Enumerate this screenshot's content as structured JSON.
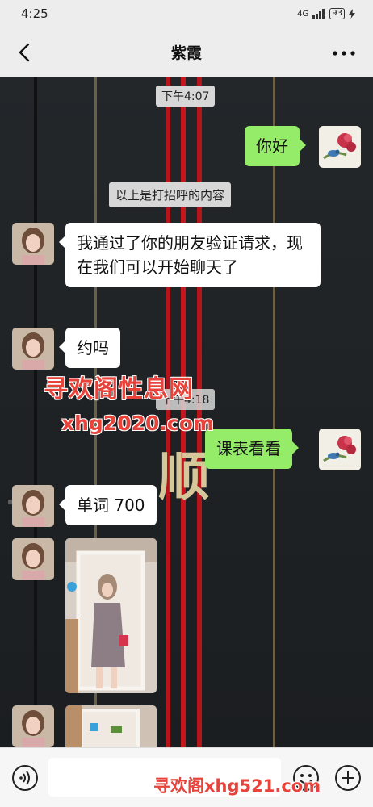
{
  "status_bar": {
    "time": "4:25",
    "network": "4G",
    "battery": "93"
  },
  "header": {
    "title": "紫霞"
  },
  "messages": {
    "time1": "下午4:07",
    "out_hello": "你好",
    "system_note": "以上是打招呼的内容",
    "in_verify": "我通过了你的朋友验证请求，现在我们可以开始聊天了",
    "in_yue": "约吗",
    "time2": "下午4:18",
    "out_schedule": "课表看看",
    "in_words": "单词 700"
  },
  "watermarks": {
    "site_name": "寻欢阁性息网",
    "site_url": "xhg2020.com",
    "bottom": "寻欢阁xhg521.com",
    "deco_char": "顺"
  },
  "icons": {
    "back": "chevron-left-icon",
    "more": "more-dots-icon",
    "voice": "voice-icon",
    "emoji": "emoji-icon",
    "add": "plus-circle-icon"
  },
  "colors": {
    "outgoing_bubble": "#95ec69",
    "incoming_bubble": "#ffffff",
    "header_bg": "#ededed",
    "chat_bg": "#1e2124",
    "accent_red": "#c4161c"
  }
}
